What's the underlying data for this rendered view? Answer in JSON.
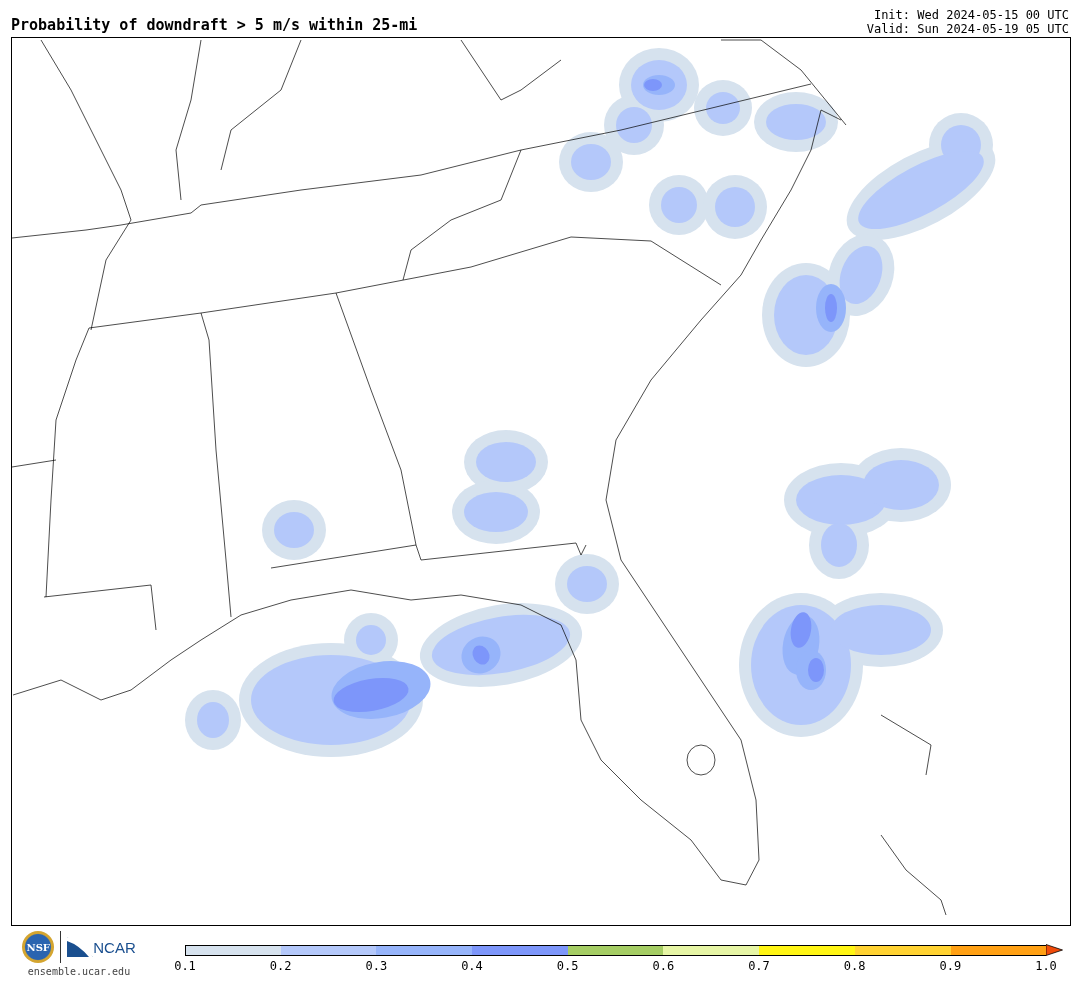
{
  "title": "Probability of downdraft > 5 m/s within 25-mi",
  "init": "Init: Wed 2024-05-15 00 UTC",
  "valid": "Valid: Sun 2024-05-19 05 UTC",
  "logos": {
    "nsf": "NSF",
    "ncar": "NCAR",
    "url": "ensemble.ucar.edu"
  },
  "colorbar": {
    "segments": [
      {
        "color": "#d6e2ee"
      },
      {
        "color": "#b4c8fa"
      },
      {
        "color": "#96b4fa"
      },
      {
        "color": "#7d96fa"
      },
      {
        "color": "#a5cd64"
      },
      {
        "color": "#e6f5a5"
      },
      {
        "color": "#fff514"
      },
      {
        "color": "#ffd232"
      },
      {
        "color": "#ffa014"
      },
      {
        "kind": "arrow",
        "color": "#f04b0a"
      }
    ],
    "ticks": [
      "0.1",
      "0.2",
      "0.3",
      "0.4",
      "0.5",
      "0.6",
      "0.7",
      "0.8",
      "0.9",
      "1.0"
    ]
  }
}
